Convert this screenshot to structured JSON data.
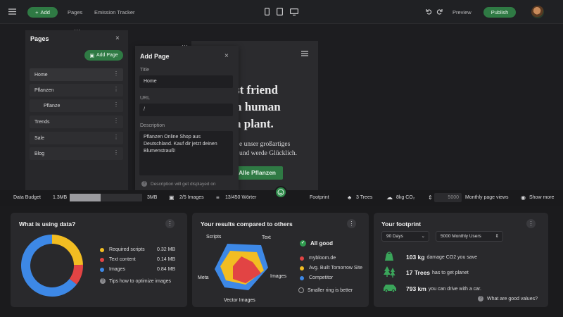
{
  "topbar": {
    "add_label": "Add",
    "pages_label": "Pages",
    "project_name": "Emission Tracker",
    "preview_label": "Preview",
    "publish_label": "Publish"
  },
  "pages_panel": {
    "title": "Pages",
    "add_page_label": "Add Page",
    "items": [
      {
        "label": "Home"
      },
      {
        "label": "Pflanzen"
      },
      {
        "label": "Pflanze"
      },
      {
        "label": "Trends"
      },
      {
        "label": "Sale"
      },
      {
        "label": "Blog"
      }
    ]
  },
  "add_page_dialog": {
    "title": "Add Page",
    "title_label": "Title",
    "title_value": "Home",
    "url_label": "URL",
    "url_value": "/",
    "description_label": "Description",
    "description_value": "Pflanzen Online Shop aus Deutschland. Kauf dir jetzt deinen Blumenstrauß!",
    "hint": "Description will get displayed on"
  },
  "preview": {
    "heading_lines": [
      "st friend",
      "n human",
      "a plant."
    ],
    "sub_lines": [
      "e unser großartiges",
      "und werde Glücklich."
    ],
    "cta_label": "Alle Pflanzen"
  },
  "budget_bar": {
    "label": "Data Budget",
    "used": "1.3MB",
    "total": "3MB",
    "usage_fraction": 0.43,
    "images": "2/5 Images",
    "words": "13/450 Wörter",
    "footprint_label": "Footprint",
    "trees": "3 Trees",
    "co2": "8kg CO₂",
    "views_value": "5000",
    "views_label": "Monthly page views",
    "show_more": "Show more"
  },
  "card_data_usage": {
    "title": "What is using data?",
    "legend": [
      {
        "label": "Required scripts",
        "value": "0.32 MB",
        "color": "#f2bd22"
      },
      {
        "label": "Text content",
        "value": "0.14 MB",
        "color": "#e24444"
      },
      {
        "label": "Images",
        "value": "0.84 MB",
        "color": "#3d88e6"
      }
    ],
    "tip": "Tips how to optimize images"
  },
  "card_compare": {
    "title": "Your results compared to others",
    "axes": [
      "Scripts",
      "Text",
      "Images",
      "Vector Images",
      "Meta"
    ],
    "status": "All good",
    "legend": [
      {
        "label": "mybloom.de",
        "color": "#e24444"
      },
      {
        "label": "Avg. Built Tomorrow Site",
        "color": "#f2bd22"
      },
      {
        "label": "Competitor",
        "color": "#3d88e6"
      }
    ],
    "hint": "Smaller ring is better"
  },
  "card_footprint": {
    "title": "Your footprint",
    "period": "90 Days",
    "users": "5000 Monthly Users",
    "rows": [
      {
        "value": "103 kg",
        "text": "damage CO2 you save"
      },
      {
        "value": "17 Trees",
        "text": "has to get planet"
      },
      {
        "value": "793 km",
        "text": "you can drive with a car."
      }
    ],
    "hint": "What are good values?"
  },
  "chart_data": {
    "type": "pie",
    "categories": [
      "Required scripts",
      "Text content",
      "Images"
    ],
    "values": [
      0.32,
      0.14,
      0.84
    ],
    "units": "MB"
  }
}
